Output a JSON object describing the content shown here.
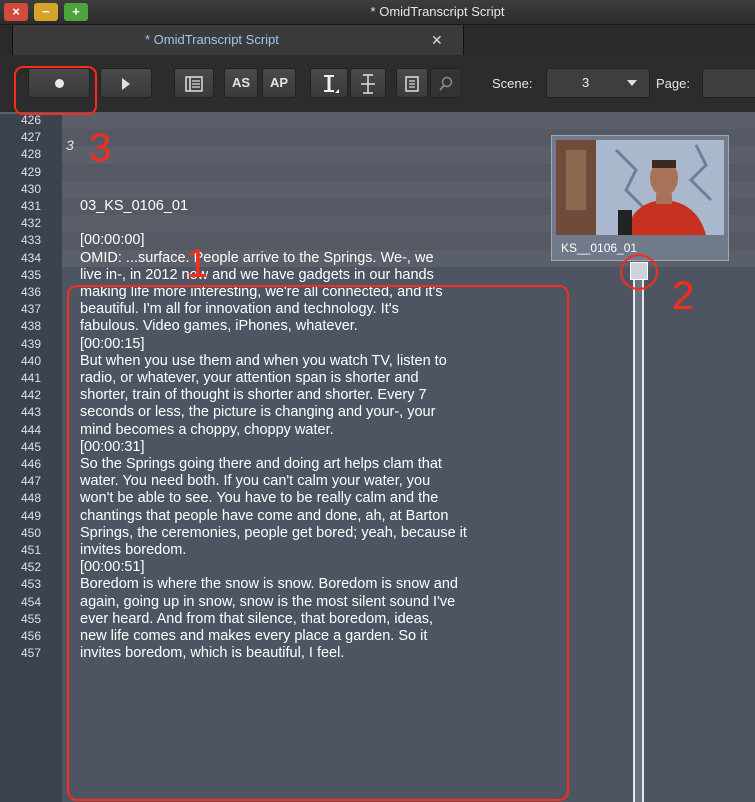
{
  "window": {
    "title": "* OmidTranscript Script",
    "close_glyph": "×",
    "minimize_glyph": "−",
    "maximize_glyph": "+"
  },
  "tab": {
    "label": "* OmidTranscript Script",
    "close_glyph": "✕"
  },
  "toolbar": {
    "as_label": "AS",
    "ap_label": "AP",
    "scene_label": "Scene:",
    "scene_value": "3",
    "page_label": "Page:",
    "page_value": ""
  },
  "script": {
    "scene_number": "3",
    "clip_name": "03_KS_0106_01",
    "line_numbers": [
      "426",
      "427",
      "428",
      "429",
      "430",
      "431",
      "432",
      "433",
      "434",
      "435",
      "436",
      "437",
      "438",
      "439",
      "440",
      "441",
      "442",
      "443",
      "444",
      "445",
      "446",
      "447",
      "448",
      "449",
      "450",
      "451",
      "452",
      "453",
      "454",
      "455",
      "456",
      "457"
    ],
    "lines": [
      "",
      "",
      "",
      "",
      "",
      "03_KS_0106_01",
      "",
      "[00:00:00]",
      "OMID: ...surface.  People arrive to the Springs.  We-, we",
      "live in-, in 2012 now and we have gadgets in our hands",
      "making life more interesting, we're all connected, and it's",
      "beautiful.  I'm all for innovation and technology.  It's",
      "fabulous.  Video games, iPhones, whatever.",
      "[00:00:15]",
      "But when you use them and when you watch TV, listen to",
      "radio, or whatever, your attention span is shorter and",
      "shorter, train of thought is shorter and shorter.  Every 7",
      "seconds or less, the picture is changing and your-, your",
      "mind becomes a choppy, choppy water.",
      "[00:00:31]",
      "So the Springs going there and doing art helps clam that",
      "water.  You need both.  If you can't calm your water, you",
      "won't be able to see.  You have to be really calm and the",
      "chantings that people have come and done, ah, at Barton",
      "Springs, the ceremonies, people get bored; yeah, because it",
      "invites boredom.",
      "[00:00:51]",
      "Boredom is where the snow is snow.  Boredom is snow and",
      "again, going up in snow, snow is the most silent sound I've",
      "ever heard.  And from that silence, that boredom, ideas,",
      "new life comes and makes every place a garden.  So it",
      "invites boredom, which is beautiful, I feel."
    ]
  },
  "thumbnail": {
    "caption": "KS__0106_01"
  },
  "annotations": {
    "one": "1",
    "two": "2",
    "three": "3"
  },
  "colors": {
    "annotation_red": "#ff2a1a",
    "tab_label_blue": "#9ec7ee",
    "script_bg": "#4d5563"
  }
}
